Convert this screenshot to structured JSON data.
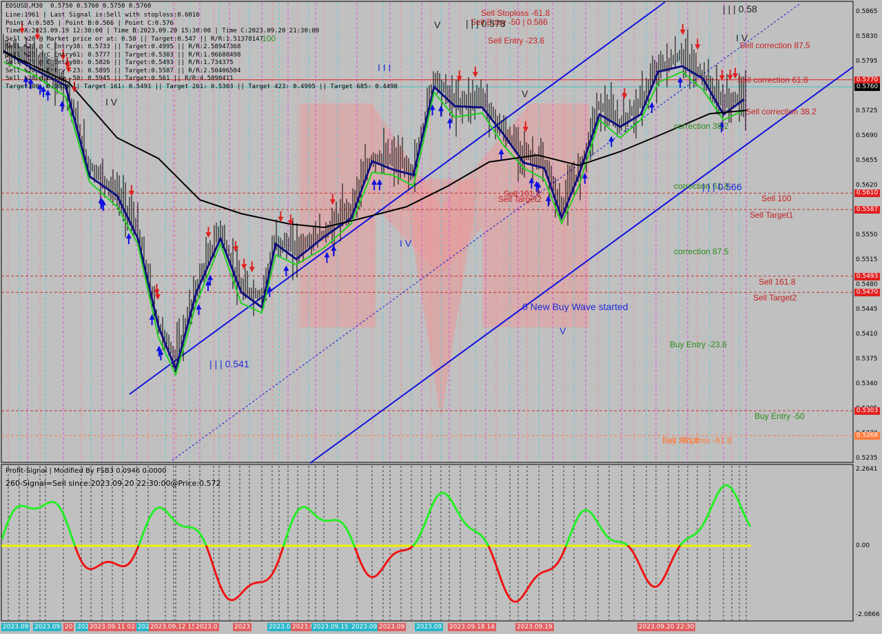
{
  "symbol_line": "EOSUSD,M30  0.5750 0.5760 0.5750 0.5760",
  "info_lines": [
    "Line:1961 | Last Signal is:Sell with stoploss:0.6016",
    "Point A:0.585 | Point B:0.566 | Point C:0.576",
    "Time A:2023.09.19 12:30:00 | Time B:2023.09.20 15:30:00 | Time C:2023.09.20 21:30:00",
    "Sell %20 @ Market price or at: 0.58 || Target:0.547 || R/R:1.51378147",
    "Sell %20 @ C_Entry38: 0.5733 || Target:0.4995 || R/R:2.58947368",
    "Sell %20 @ C_Entry61: 0.5777 || Target:0.5303 || R/R:1.96680498",
    "Sell %20 @ C_Entry88: 0.5826 || Target:0.5493 || R/R:1.734375",
    "Sell %20 @ Entry -23: 0.5895 || Target:0.5587 || R/R:2.50406504",
    "Sell %20 @ Entry -50: 0.5945 || Target:0.561 || R/R:4.5890411",
    "Target100: 0.5610 || Target 161: 0.5493 || Target 261: 0.5303 || Target 423: 0.4995 || Target 685: 0.4498"
  ],
  "chart_labels": [
    {
      "text": "Sell Stoploss -61.8",
      "cls": "red"
    },
    {
      "text": "Sell Entry -50 | 0.586",
      "cls": "red"
    },
    {
      "text": "Sell Entry -23.6",
      "cls": "red"
    },
    {
      "text": "Sell correction 87.5",
      "cls": "red"
    },
    {
      "text": "Sell correction 61.8",
      "cls": "red"
    },
    {
      "text": "Sell correction 38.2",
      "cls": "red"
    },
    {
      "text": "correction 38.2",
      "cls": "green"
    },
    {
      "text": "correction 61.8",
      "cls": "green"
    },
    {
      "text": "Sell 100",
      "cls": "red"
    },
    {
      "text": "Sell Target1",
      "cls": "red"
    },
    {
      "text": "correction 87.5",
      "cls": "green"
    },
    {
      "text": "Sell 161.8",
      "cls": "red"
    },
    {
      "text": "Sell Target2",
      "cls": "red"
    },
    {
      "text": "Buy Entry -23.6",
      "cls": "green"
    },
    {
      "text": "Buy Entry -50",
      "cls": "green"
    },
    {
      "text": "Sell 261.8",
      "cls": "red"
    },
    {
      "text": "Buy Stoploss -61.8",
      "cls": "red"
    },
    {
      "text": "Sell 161.8",
      "cls": "red"
    },
    {
      "text": "Sell Target2",
      "cls": "red"
    },
    {
      "text": "0 New Buy Wave started",
      "cls": "blue"
    },
    {
      "text": "| | | 0.541",
      "cls": "blue"
    },
    {
      "text": "| | | 0.566",
      "cls": "blue"
    },
    {
      "text": "| | | 0.58",
      "cls": "dark"
    },
    {
      "text": "| | | 0.578",
      "cls": "dark"
    },
    {
      "text": "100",
      "cls": "green"
    },
    {
      "text": "V",
      "cls": "dark"
    },
    {
      "text": "I V",
      "cls": "dark"
    },
    {
      "text": "I V",
      "cls": "dark"
    },
    {
      "text": "I V",
      "cls": "blue"
    },
    {
      "text": "I I I",
      "cls": "blue"
    },
    {
      "text": "V",
      "cls": "blue"
    },
    {
      "text": "V",
      "cls": "dark"
    }
  ],
  "price_ticks": [
    "0.5865",
    "0.5830",
    "0.5795",
    "0.5762",
    "0.5725",
    "0.5690",
    "0.5655",
    "0.5620",
    "0.5585",
    "0.5550",
    "0.5515",
    "0.5480",
    "0.5445",
    "0.5410",
    "0.5375",
    "0.5340",
    "0.5305",
    "0.5270",
    "0.5235"
  ],
  "price_boxes": [
    {
      "value": "0.5770",
      "color": "#e02020"
    },
    {
      "value": "0.5760",
      "color": "#000000"
    },
    {
      "value": "0.5610",
      "color": "#e02020"
    },
    {
      "value": "0.5587",
      "color": "#e02020"
    },
    {
      "value": "0.5493",
      "color": "#e02020"
    },
    {
      "value": "0.5470",
      "color": "#e02020"
    },
    {
      "value": "0.5303",
      "color": "#e02020"
    },
    {
      "value": "0.5268",
      "color": "#ff7a3a"
    }
  ],
  "indicator": {
    "title": "Profit-Signal | Modified By FSB3 0.0946 0.0000",
    "signal": "260-Signal=Sell since:2023.09.20 22:30:00@Price:0.572",
    "ticks": [
      "2.2641",
      "0.00",
      "-2.0866"
    ]
  },
  "time_labels": [
    {
      "text": "2023.09",
      "cls": ""
    },
    {
      "text": "2023.09",
      "cls": ""
    },
    {
      "text": "20",
      "cls": "sell"
    },
    {
      "text": "2023",
      "cls": ""
    },
    {
      "text": "2023.09.11 02:00",
      "cls": "sell"
    },
    {
      "text": "2023.09.11",
      "cls": ""
    },
    {
      "text": "2023.09.12 15:30",
      "cls": "sell"
    },
    {
      "text": "2023.0",
      "cls": "sell"
    },
    {
      "text": "2023",
      "cls": "sell"
    },
    {
      "text": "2023.09.14",
      "cls": ""
    },
    {
      "text": "2023.09",
      "cls": "sell"
    },
    {
      "text": "2023.09.15",
      "cls": ""
    },
    {
      "text": "2023.09",
      "cls": ""
    },
    {
      "text": "2023.09",
      "cls": "sell"
    },
    {
      "text": "2023.09",
      "cls": ""
    },
    {
      "text": "2023.09.18 14",
      "cls": "sell"
    },
    {
      "text": "2023.09.19",
      "cls": "sell"
    },
    {
      "text": "2023.09.20 22:30",
      "cls": "sell"
    }
  ],
  "colors": {
    "bg": "#c0c0c0",
    "red": "#e02020",
    "blue": "#1010e0",
    "green": "#20d020",
    "ma_black": "#000000",
    "ma_navy": "#101080",
    "signal_zero": "#f0f000",
    "cyan": "#29b6c9"
  }
}
